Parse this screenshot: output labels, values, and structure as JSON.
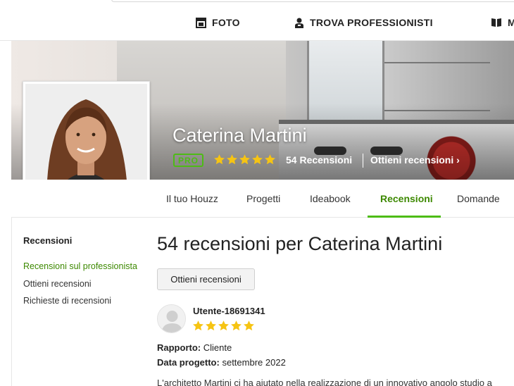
{
  "top_nav": {
    "items": [
      {
        "label": "FOTO",
        "icon": "photo-icon"
      },
      {
        "label": "TROVA PROFESSIONISTI",
        "icon": "professional-icon"
      },
      {
        "label": "M",
        "icon": "book-icon"
      }
    ]
  },
  "profile": {
    "name": "Caterina Martini",
    "badge": "PRO",
    "rating": 5,
    "reviews_count_label": "54 Recensioni",
    "get_reviews_link": "Ottieni recensioni ›"
  },
  "tabs": [
    {
      "label": "Il tuo Houzz",
      "active": false
    },
    {
      "label": "Progetti",
      "active": false
    },
    {
      "label": "Ideabook",
      "active": false
    },
    {
      "label": "Recensioni",
      "active": true
    },
    {
      "label": "Domande",
      "active": false
    }
  ],
  "sidebar": {
    "title": "Recensioni",
    "links": [
      {
        "label": "Recensioni sul professionista",
        "active": true
      },
      {
        "label": "Ottieni recensioni",
        "active": false
      },
      {
        "label": "Richieste di recensioni",
        "active": false
      }
    ]
  },
  "main": {
    "title": "54 recensioni per Caterina Martini",
    "get_reviews_button": "Ottieni recensioni",
    "review": {
      "user": "Utente-18691341",
      "rating": 5,
      "relationship_label": "Rapporto:",
      "relationship_value": "Cliente",
      "project_date_label": "Data progetto:",
      "project_date_value": "settembre 2022",
      "text": "L'architetto Martini ci ha aiutato nella realizzazione di un innovativo angolo studio a"
    }
  },
  "colors": {
    "accent_green": "#4dbc15",
    "active_text_green": "#3d8901",
    "star_yellow": "#f6c413"
  }
}
